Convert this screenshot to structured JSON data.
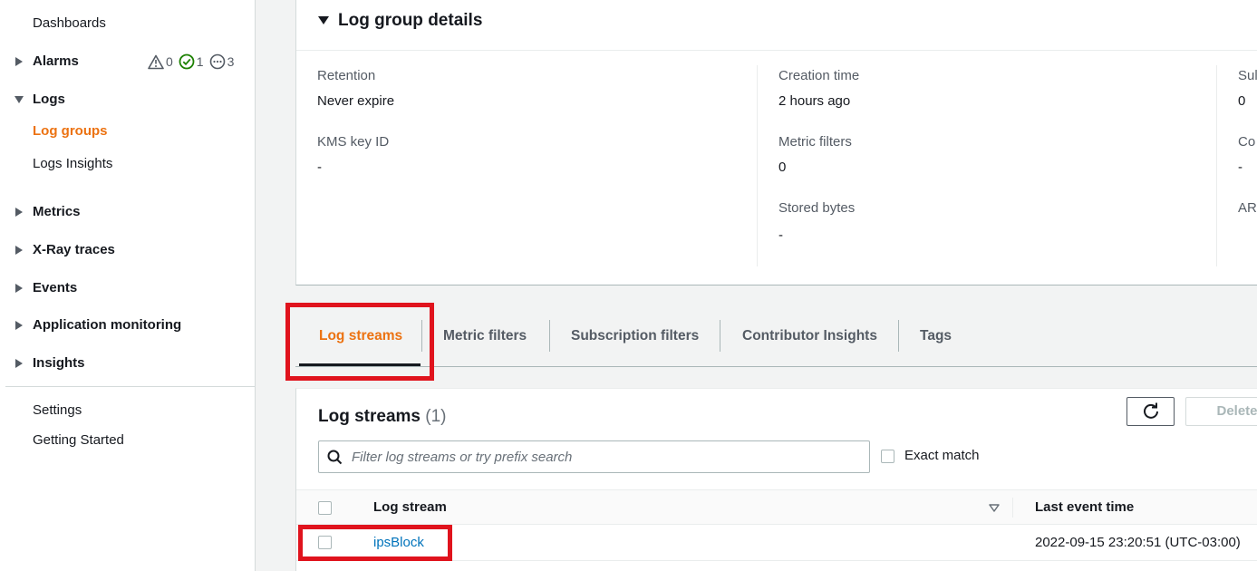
{
  "sidebar": {
    "items": [
      {
        "label": "Dashboards"
      },
      {
        "label": "Alarms"
      },
      {
        "label": "Logs"
      },
      {
        "label": "Log groups"
      },
      {
        "label": "Logs Insights"
      },
      {
        "label": "Metrics"
      },
      {
        "label": "X-Ray traces"
      },
      {
        "label": "Events"
      },
      {
        "label": "Application monitoring"
      },
      {
        "label": "Insights"
      },
      {
        "label": "Settings"
      },
      {
        "label": "Getting Started"
      }
    ],
    "alarm_counts": {
      "alarm": "0",
      "ok": "1",
      "insufficient": "3"
    }
  },
  "details": {
    "title": "Log group details",
    "fields": [
      {
        "label": "Retention",
        "value": "Never expire"
      },
      {
        "label": "KMS key ID",
        "value": "-"
      },
      {
        "label": "Creation time",
        "value": "2 hours ago"
      },
      {
        "label": "Metric filters",
        "value": "0"
      },
      {
        "label": "Stored bytes",
        "value": "-"
      },
      {
        "label": "Sul",
        "value": "0"
      },
      {
        "label": "Co",
        "value": "-"
      },
      {
        "label": "AR",
        "value": ""
      }
    ]
  },
  "tabs": [
    {
      "label": "Log streams"
    },
    {
      "label": "Metric filters"
    },
    {
      "label": "Subscription filters"
    },
    {
      "label": "Contributor Insights"
    },
    {
      "label": "Tags"
    }
  ],
  "streams": {
    "title": "Log streams",
    "count": "(1)",
    "delete_label": "Delete",
    "search_placeholder": "Filter log streams or try prefix search",
    "search_value": "",
    "exact_match_label": "Exact match",
    "columns": [
      "Log stream",
      "Last event time"
    ],
    "rows": [
      {
        "name": "ipsBlock",
        "last_event": "2022-09-15 23:20:51 (UTC-03:00)"
      }
    ]
  },
  "colors": {
    "accent": "#ec7211",
    "link": "#0073bb",
    "highlight": "#e0131d"
  },
  "icons": [
    "caret-right-icon",
    "caret-down-icon",
    "warning-icon",
    "check-circle-icon",
    "ellipsis-circle-icon",
    "refresh-icon",
    "search-icon",
    "sort-icon"
  ]
}
